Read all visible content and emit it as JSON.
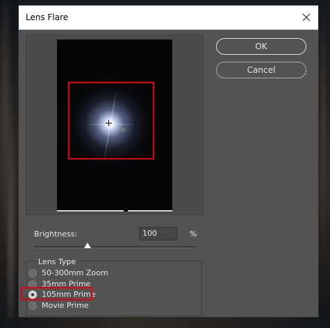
{
  "dialog": {
    "title": "Lens Flare",
    "close_icon": "close-icon"
  },
  "buttons": {
    "ok": "OK",
    "cancel": "Cancel"
  },
  "brightness": {
    "label": "Brightness:",
    "value": "100",
    "unit": "%",
    "slider_fraction": 0.33
  },
  "lens_type": {
    "title": "Lens Type",
    "options": [
      {
        "label": "50-300mm Zoom",
        "checked": false
      },
      {
        "label": "35mm Prime",
        "checked": false
      },
      {
        "label": "105mm Prime",
        "checked": true
      },
      {
        "label": "Movie Prime",
        "checked": false
      }
    ]
  },
  "colors": {
    "dialog_bg": "#535353",
    "highlight": "#e3000b",
    "titlebar_bg": "#ffffff"
  }
}
